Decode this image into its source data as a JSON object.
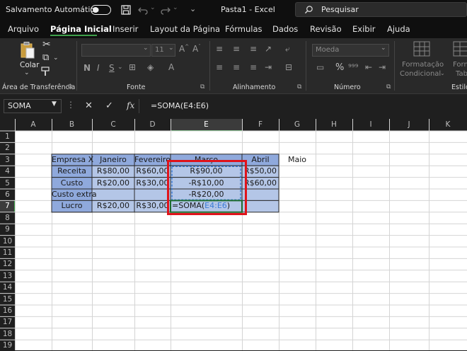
{
  "titlebar": {
    "autosave_label": "Salvamento Automático",
    "title": "Pasta1  -  Excel",
    "search_placeholder": "Pesquisar"
  },
  "menu": {
    "items": [
      "Arquivo",
      "Página Inicial",
      "Inserir",
      "Layout da Página",
      "Fórmulas",
      "Dados",
      "Revisão",
      "Exibir",
      "Ajuda"
    ],
    "active": "Página Inicial"
  },
  "ribbon": {
    "clipboard": {
      "paste_label": "Colar",
      "group_label": "Área de Transferência"
    },
    "font": {
      "font_size": "11",
      "bold": "N",
      "italic": "I",
      "underline": "S",
      "group_label": "Fonte"
    },
    "alignment": {
      "group_label": "Alinhamento"
    },
    "number": {
      "format": "Moeda",
      "group_label": "Número"
    },
    "styles": {
      "conditional_label_1": "Formatação",
      "conditional_label_2": "Condicional",
      "table_label_1": "Form",
      "table_label_2": "Tab",
      "group_label": "Estilo"
    }
  },
  "formula_bar": {
    "name_box": "SOMA",
    "formula": "=SOMA(E4:E6)"
  },
  "sheet": {
    "columns": [
      "A",
      "B",
      "C",
      "D",
      "E",
      "F",
      "G",
      "H",
      "I",
      "J",
      "K"
    ],
    "rows": [
      "1",
      "2",
      "3",
      "4",
      "5",
      "6",
      "7",
      "8",
      "9",
      "10",
      "11",
      "12",
      "13",
      "14",
      "15",
      "16",
      "17",
      "18",
      "19"
    ],
    "table": {
      "headers": [
        "Empresa X",
        "Janeiro",
        "Fevereiro",
        "Março",
        "Abril",
        "Maio"
      ],
      "data": [
        [
          "Receita",
          "R$80,00",
          "R$60,00",
          "R$90,00",
          "R$50,00",
          ""
        ],
        [
          "Custo",
          "R$20,00",
          "R$30,00",
          "-R$10,00",
          "R$60,00",
          ""
        ],
        [
          "Custo extra",
          "",
          "",
          "-R$20,00",
          "",
          ""
        ],
        [
          "Lucro",
          "R$20,00",
          "R$30,00",
          "",
          "",
          ""
        ]
      ],
      "edit_prefix": "=SOMA(",
      "edit_ref": "E4:E6",
      "edit_suffix": ")"
    }
  },
  "colors": {
    "header_fill": "#8fa9dc",
    "body_fill": "#b4c6e7",
    "highlight": "#e0131b",
    "ribbon_accent": "#3ea04a",
    "ref_blue": "#3a7bd5"
  }
}
